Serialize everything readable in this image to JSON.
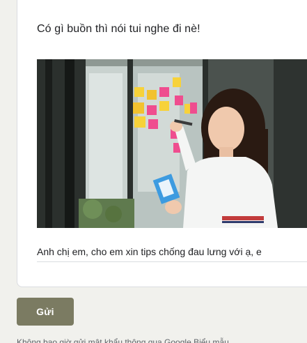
{
  "question": {
    "title": "Có gì buồn thì nói tui nghe đi nè!",
    "answer_value": "Anh chị em, cho em xin tips chống đau lưng với ạ, e"
  },
  "actions": {
    "submit_label": "Gửi"
  },
  "footer": {
    "note": "Không bao giờ gửi mật khẩu thông qua Google Biểu mẫu"
  },
  "colors": {
    "page_background": "#f1f1ed",
    "submit_button": "#7b7b62",
    "card_background": "#ffffff"
  }
}
